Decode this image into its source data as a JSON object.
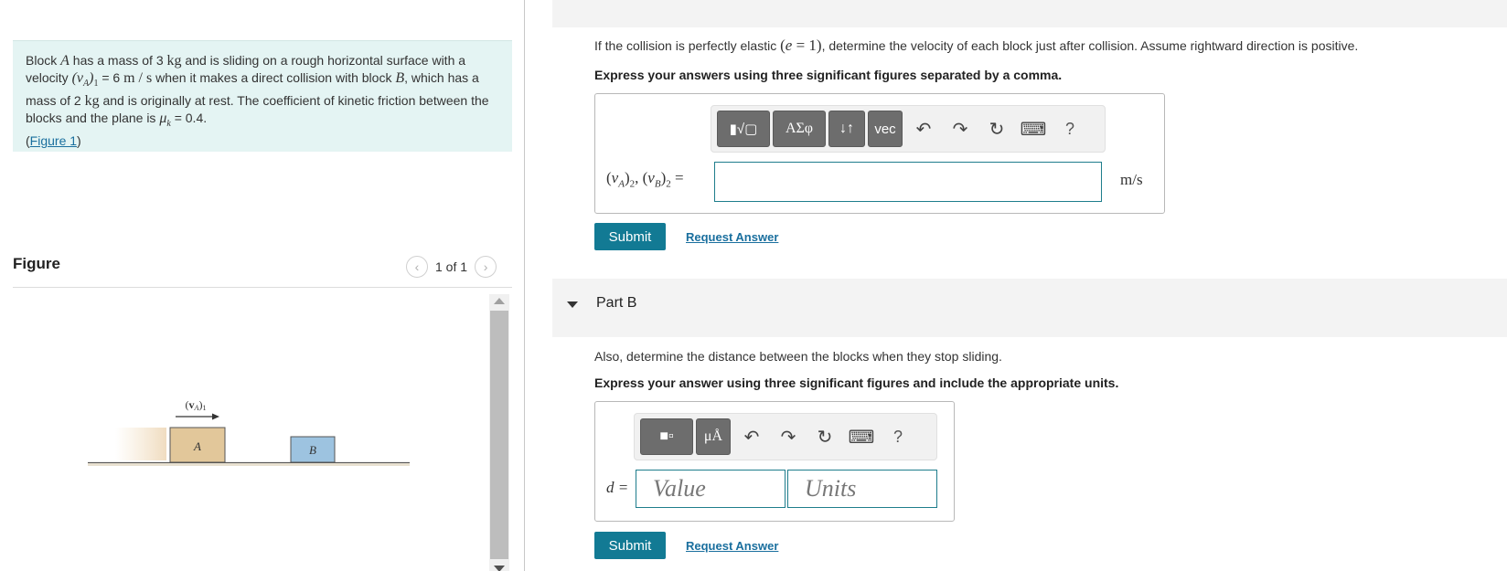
{
  "problem": {
    "p1": "Block ",
    "var_a": "A",
    "p2": " has a mass of 3 ",
    "unit_kg": "kg",
    "p3": " and is sliding on a rough horizontal surface with a velocity ",
    "v_a1": "(vA)1",
    "p4": " = 6 ",
    "unit_ms": "m / s",
    "p5": " when it makes a direct collision with block ",
    "var_b": "B",
    "p6": ", which has a mass of 2 ",
    "unit_kg2": "kg",
    "p7": " and is originally at rest. The coefficient of kinetic friction between the blocks and the plane is ",
    "mu": "μk",
    "p8": " = 0.4.",
    "figure_link": "Figure 1"
  },
  "figure": {
    "title": "Figure",
    "pager": "1 of 1",
    "velocity_label": "(vA)1",
    "block_a_label": "A",
    "block_b_label": "B"
  },
  "part_a": {
    "question_1": "If the collision is perfectly elastic ",
    "question_math": "(e = 1)",
    "question_2": ", determine the velocity of each block just after collision. Assume rightward direction is positive.",
    "instruction": "Express your answers using three significant figures separated by a comma.",
    "toolbar": {
      "templates_label": "▮√▢",
      "greek_label": "ΑΣφ",
      "arrows_label": "↓↑",
      "vec_label": "vec"
    },
    "equation_label": "(vA)2, (vB)2 =",
    "input_value": "",
    "unit": "m/s",
    "submit_label": "Submit",
    "request_label": "Request Answer"
  },
  "part_b": {
    "title": "Part B",
    "question": "Also, determine the distance between the blocks when they stop sliding.",
    "instruction": "Express your answer using three significant figures and include the appropriate units.",
    "toolbar": {
      "units_label": "μÅ"
    },
    "equation_label": "d =",
    "value_placeholder": "Value",
    "units_placeholder": "Units",
    "submit_label": "Submit",
    "request_label": "Request Answer"
  },
  "colors": {
    "accent": "#127a94",
    "link": "#1a6f9e",
    "problem_bg": "#e4f4f3",
    "block_a": "#e2c79a",
    "block_b": "#9dc3e0"
  }
}
